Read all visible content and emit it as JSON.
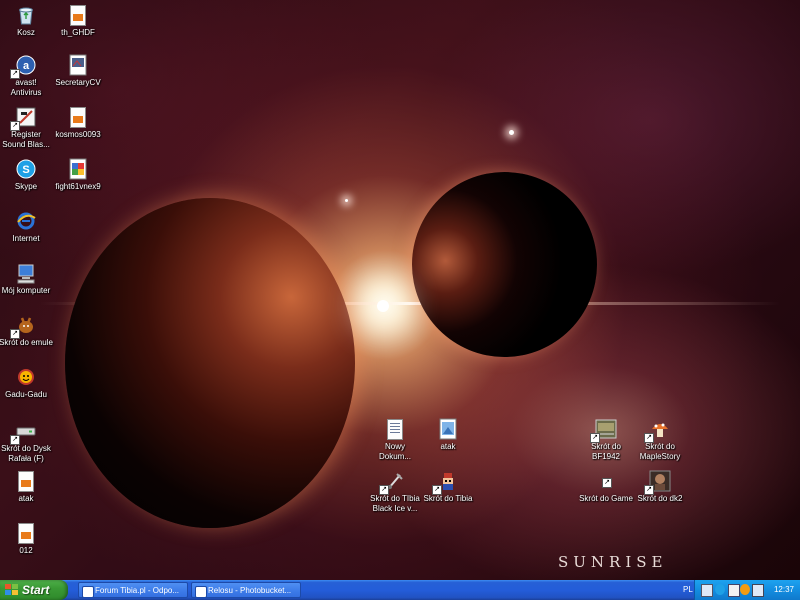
{
  "wallpaper": {
    "brand_text": "SUNRISE"
  },
  "desktop_icons": [
    {
      "id": "kosz",
      "label": "Kosz",
      "icon": "recycle-bin-icon"
    },
    {
      "id": "th-ghdf",
      "label": "th_GHDF",
      "icon": "image-file-icon"
    },
    {
      "id": "avast",
      "label": "avast!\nAntivirus",
      "icon": "avast-icon"
    },
    {
      "id": "secretarycv",
      "label": "SecretaryCV",
      "icon": "image-file-icon"
    },
    {
      "id": "register-sound",
      "label": "Register\nSound Blas...",
      "icon": "sound-blaster-icon"
    },
    {
      "id": "kosmos",
      "label": "kosmos0093",
      "icon": "image-file-icon"
    },
    {
      "id": "skype",
      "label": "Skype",
      "icon": "skype-icon"
    },
    {
      "id": "fight61",
      "label": "fight61vnex9",
      "icon": "image-file-icon"
    },
    {
      "id": "internet",
      "label": "Internet",
      "icon": "internet-explorer-icon"
    },
    {
      "id": "moj-komputer",
      "label": "Mój komputer",
      "icon": "my-computer-icon"
    },
    {
      "id": "emule",
      "label": "Skrót do emule",
      "icon": "emule-icon"
    },
    {
      "id": "gadu",
      "label": "Gadu-Gadu",
      "icon": "gadu-gadu-icon"
    },
    {
      "id": "dysk",
      "label": "Skrót do Dysk\nRafała (F)",
      "icon": "drive-icon"
    },
    {
      "id": "atak-left",
      "label": "atak",
      "icon": "image-file-icon"
    },
    {
      "id": "012",
      "label": "012",
      "icon": "image-file-icon"
    },
    {
      "id": "nowy-dokum",
      "label": "Nowy\nDokum...",
      "icon": "text-document-icon"
    },
    {
      "id": "atak-mid",
      "label": "atak",
      "icon": "image-file-icon"
    },
    {
      "id": "tibia-black-ice",
      "label": "Skrót do TIbia\nBlack Ice v...",
      "icon": "tibia-icon"
    },
    {
      "id": "tibia",
      "label": "Skrót do Tibia",
      "icon": "tibia-icon"
    },
    {
      "id": "bf1942",
      "label": "Skrót do\nBF1942",
      "icon": "game-icon"
    },
    {
      "id": "maplestory",
      "label": "Skrót do\nMapleStory",
      "icon": "maplestory-icon"
    },
    {
      "id": "game",
      "label": "Skrót do Game",
      "icon": "shortcut-icon"
    },
    {
      "id": "dk2",
      "label": "Skrót do dk2",
      "icon": "game-icon"
    }
  ],
  "taskbar": {
    "start_label": "Start",
    "tasks": [
      {
        "label": "Forum Tibia.pl - Odpo...",
        "icon": "browser-window-icon"
      },
      {
        "label": "Relosu - Photobucket...",
        "icon": "browser-window-icon"
      }
    ],
    "language": "PL",
    "clock": "12:37"
  },
  "colors": {
    "taskbar": "#245dd9",
    "start_button": "#3a9a35",
    "tray": "#138de0"
  }
}
